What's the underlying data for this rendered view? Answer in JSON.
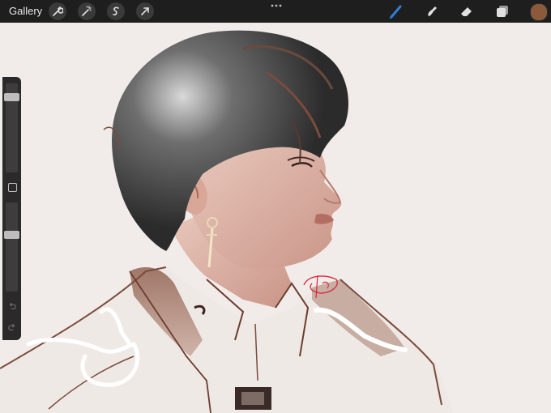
{
  "topbar": {
    "gallery_label": "Gallery",
    "left_tools": [
      "wrench-icon",
      "magic-wand-icon",
      "selection-icon",
      "transform-arrow-icon"
    ],
    "right_tools": [
      "brush-icon",
      "smudge-icon",
      "eraser-icon",
      "layers-icon"
    ],
    "active_tool": "brush-icon",
    "accent_color": "#2f7ddb",
    "current_color": "#8b5a3c"
  },
  "sidebar": {
    "brush_size_level": 0.88,
    "opacity_level": 0.65
  },
  "canvas": {
    "background": "#f1ecea",
    "signature_color": "#d8263a"
  }
}
